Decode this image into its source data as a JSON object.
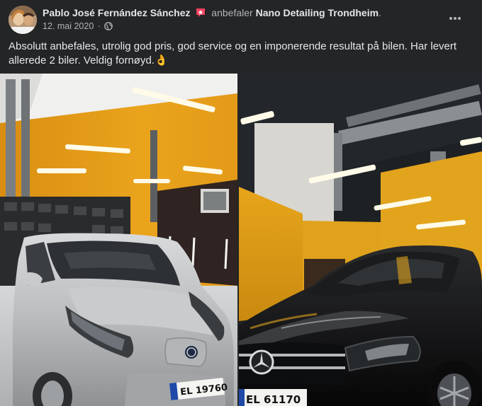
{
  "post": {
    "author": "Pablo José Fernández Sánchez",
    "action": "anbefaler",
    "page_name": "Nano Detailing Trondheim",
    "page_suffix": ".",
    "date": "12. mai 2020",
    "separator": "·",
    "text": "Absolutt anbefales, utrolig god pris, god service og en imponerende resultat på bilen. Har levert allerede 2 biler. Veldig fornøyd.",
    "emoji": "👌"
  },
  "photos": {
    "left": {
      "plate": "EL 19760"
    },
    "right": {
      "plate": "EL 61170"
    }
  },
  "icons": {
    "recommend": "recommend-badge-icon",
    "audience": "globe-icon",
    "more": "more-options-icon"
  },
  "colors": {
    "background": "#242526",
    "primary_text": "#e4e6eb",
    "secondary_text": "#b0b3b8",
    "recommend_badge": "#f3425f",
    "garage_wall": "#e8a317"
  }
}
